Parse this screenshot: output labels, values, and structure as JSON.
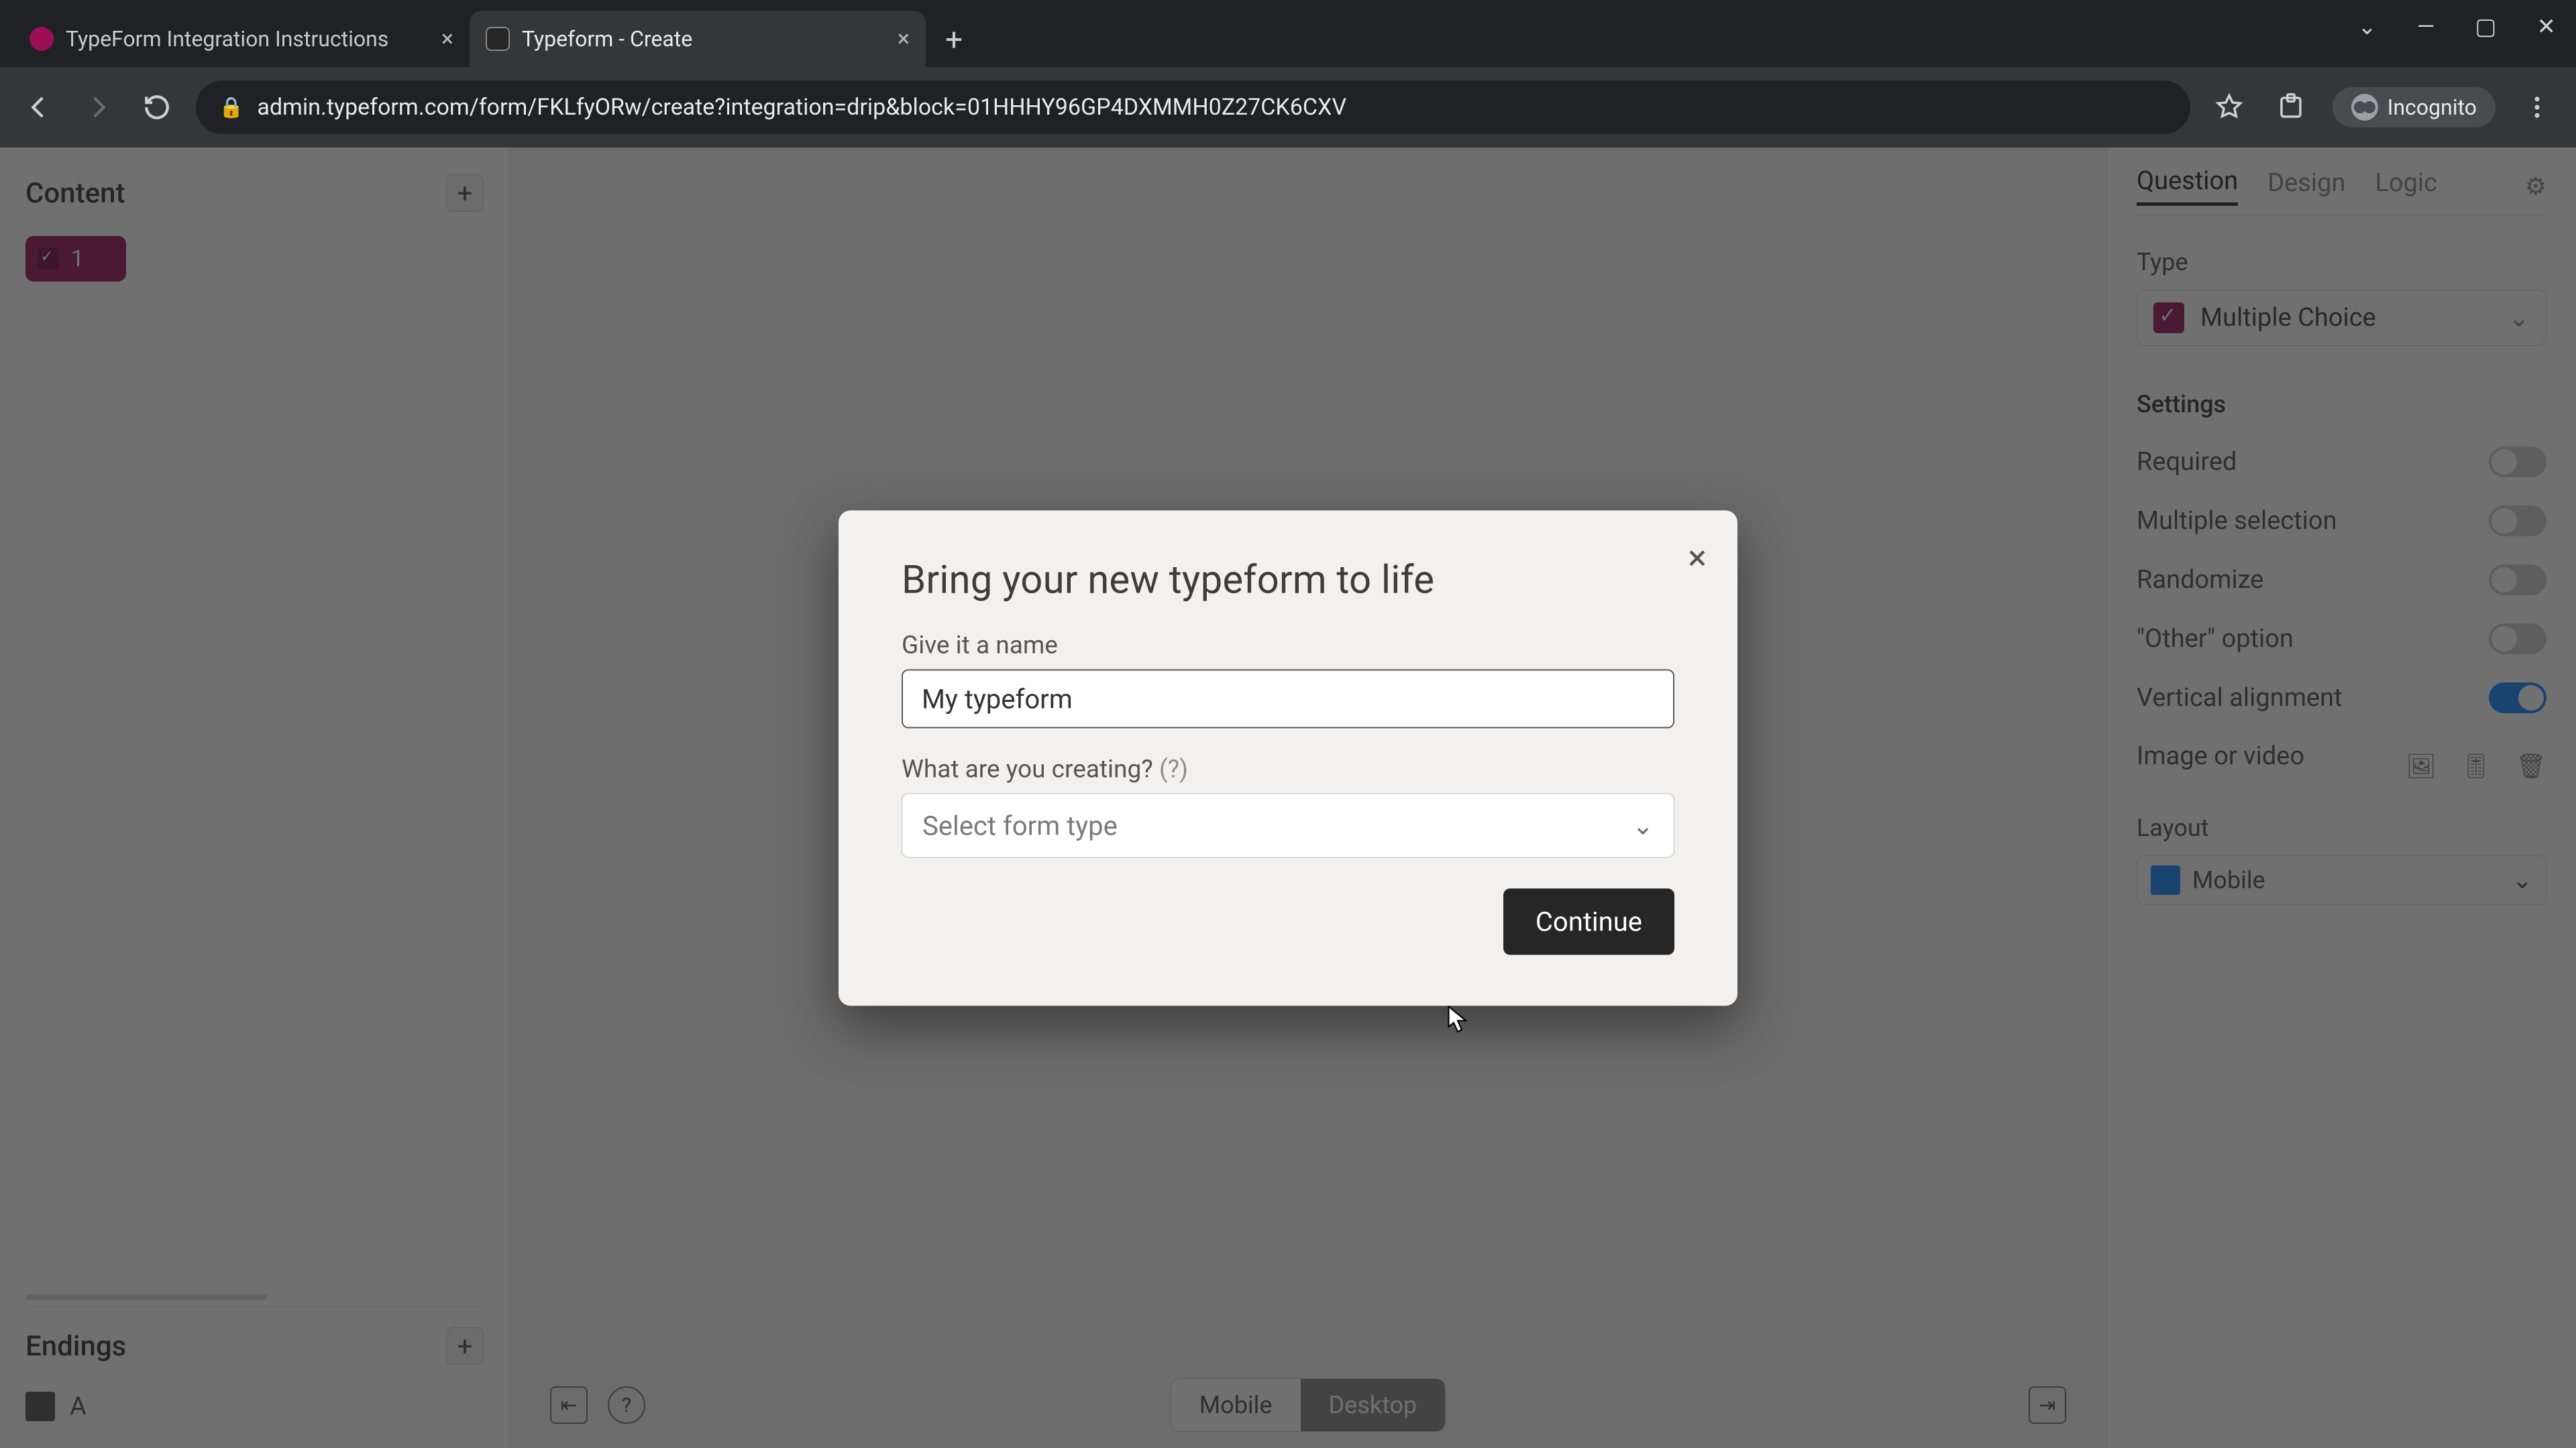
{
  "browser": {
    "tabs": [
      {
        "title": "TypeForm Integration Instructions",
        "active": false
      },
      {
        "title": "Typeform - Create",
        "active": true
      }
    ],
    "url": "admin.typeform.com/form/FKLfyORw/create?integration=drip&block=01HHHY96GP4DXMMH0Z27CK6CXV",
    "incognito_label": "Incognito"
  },
  "left_panel": {
    "content_heading": "Content",
    "block_number": "1",
    "endings_heading": "Endings",
    "ending_label": "A"
  },
  "center": {
    "viewport_mobile": "Mobile",
    "viewport_desktop": "Desktop"
  },
  "right_panel": {
    "tabs": {
      "question": "Question",
      "design": "Design",
      "logic": "Logic"
    },
    "type_label": "Type",
    "type_value": "Multiple Choice",
    "settings_heading": "Settings",
    "settings": {
      "required": "Required",
      "multiple_selection": "Multiple selection",
      "randomize": "Randomize",
      "other_option": "\"Other\" option",
      "vertical_alignment": "Vertical alignment"
    },
    "image_video_label": "Image or video",
    "layout_label": "Layout",
    "layout_value": "Mobile"
  },
  "modal": {
    "title": "Bring your new typeform to life",
    "name_label": "Give it a name",
    "name_value": "My typeform",
    "type_label": "What are you creating?",
    "type_help": "(?)",
    "type_placeholder": "Select form type",
    "continue": "Continue"
  }
}
